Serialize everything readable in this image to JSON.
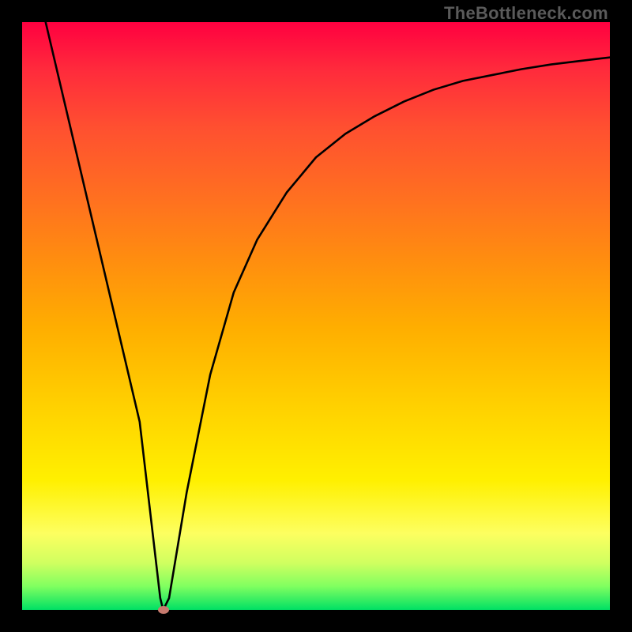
{
  "watermark": "TheBottleneck.com",
  "chart_data": {
    "type": "line",
    "title": "",
    "xlabel": "",
    "ylabel": "",
    "xlim": [
      0,
      100
    ],
    "ylim": [
      0,
      100
    ],
    "grid": false,
    "series": [
      {
        "name": "bottleneck-curve",
        "x": [
          4,
          8,
          12,
          16,
          20,
          23.5,
          24,
          25,
          28,
          32,
          36,
          40,
          45,
          50,
          55,
          60,
          65,
          70,
          75,
          80,
          85,
          90,
          95,
          100
        ],
        "y": [
          100,
          83,
          66,
          49,
          32,
          2,
          0,
          2,
          20,
          40,
          54,
          63,
          71,
          77,
          81,
          84,
          86.5,
          88.5,
          90,
          91,
          92,
          92.8,
          93.4,
          94
        ]
      }
    ],
    "marker": {
      "x": 24,
      "y": 0,
      "name": "sweet-spot"
    },
    "background_gradient": {
      "top": "#ff0040",
      "bottom": "#00e064"
    }
  }
}
